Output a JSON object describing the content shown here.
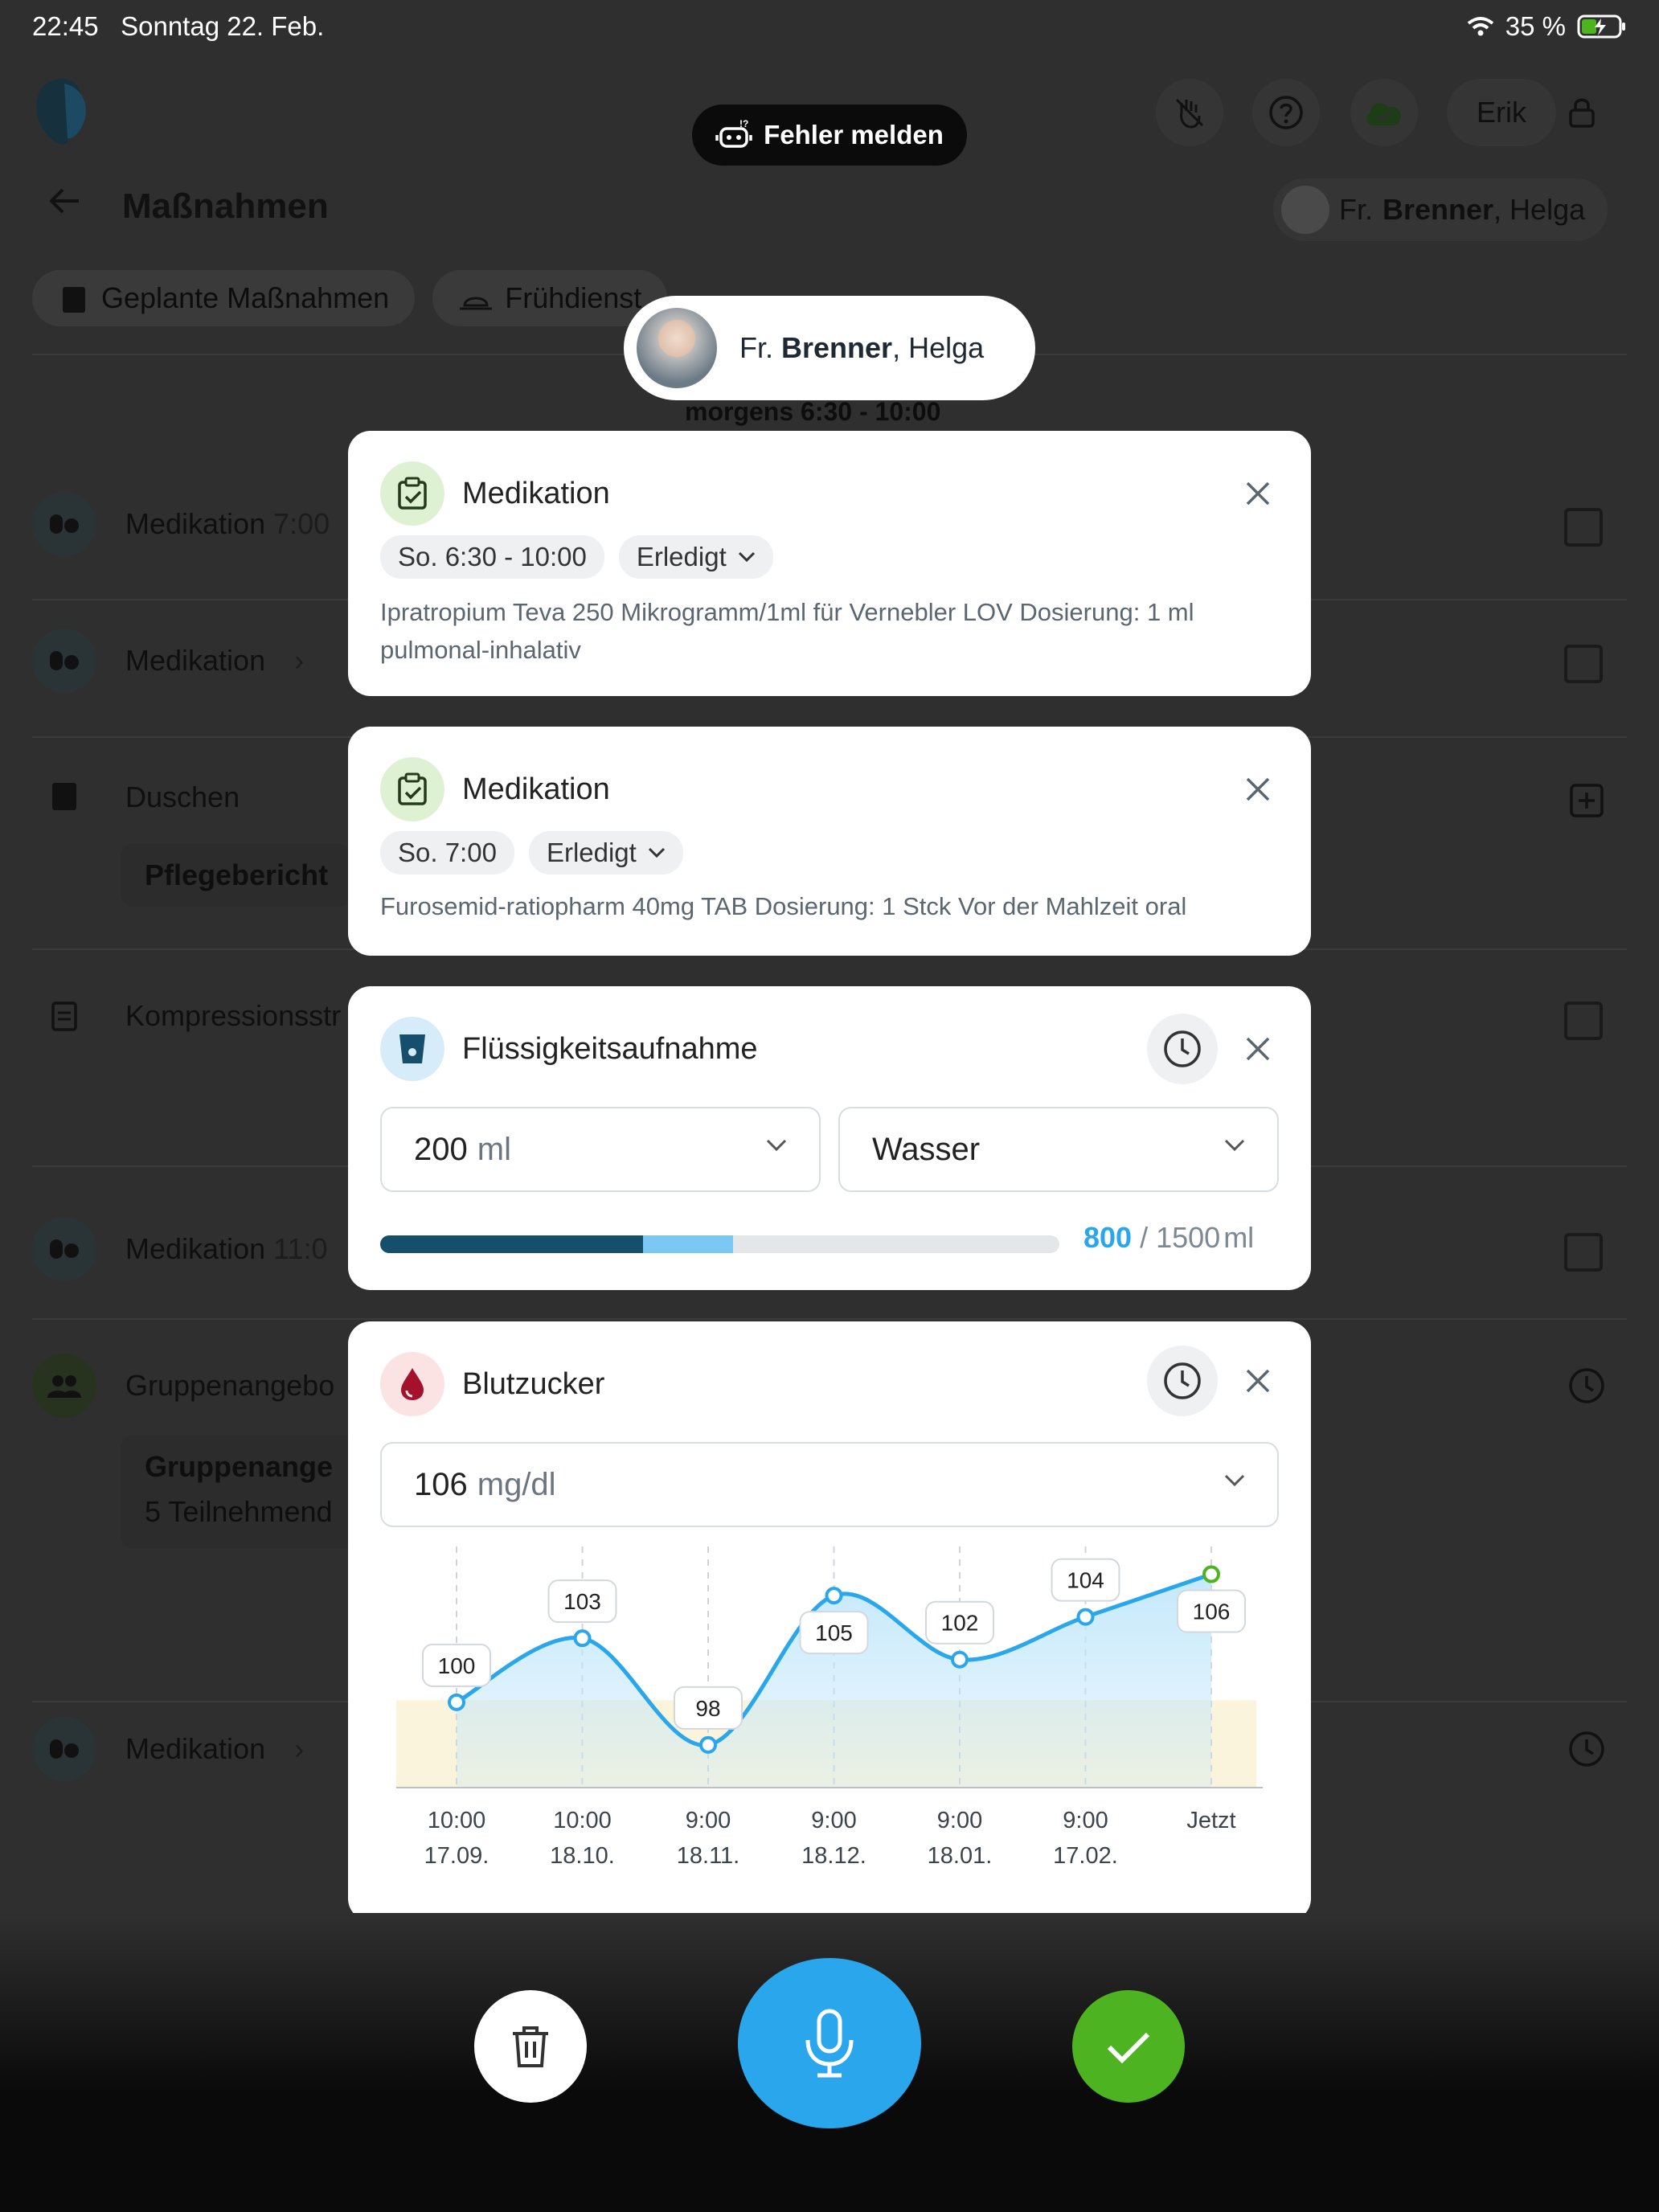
{
  "statusbar": {
    "time": "22:45",
    "date": "Sonntag 22. Feb.",
    "battery": "35 %"
  },
  "header": {
    "report_button": "Fehler melden",
    "user": "Erik",
    "page_title": "Maßnahmen",
    "patient_salutation": "Fr.",
    "patient_last": "Brenner",
    "patient_first": ", Helga"
  },
  "tabs": [
    {
      "label": "Geplante Maßnahmen"
    },
    {
      "label": "Frühdienst"
    }
  ],
  "background_list": {
    "section_label": "morgens  6:30 - 10:00",
    "rows": [
      {
        "label": "Medikation",
        "extra": "7:00"
      },
      {
        "label": "Medikation",
        "extra": "›"
      },
      {
        "label": "Duschen",
        "extra": ""
      },
      {
        "label": "Kompressionsstr",
        "extra": ""
      },
      {
        "label": "Medikation",
        "extra": "11:0"
      },
      {
        "label": "Gruppenangebo",
        "extra": ""
      },
      {
        "label": "Medikation",
        "extra": "›"
      }
    ],
    "pflegebericht": "Pflegebericht",
    "group_box_title": "Gruppenange",
    "group_box_sub": "5 Teilnehmend"
  },
  "patient_pill": {
    "salutation": "Fr.",
    "last": "Brenner",
    "first": ", Helga"
  },
  "cards": {
    "med1": {
      "title": "Medikation",
      "time": "So. 6:30 - 10:00",
      "status": "Erledigt",
      "desc": "Ipratropium Teva 250 Mikrogramm/1ml für Vernebler LOV Dosierung: 1 ml pulmonal-inhalativ"
    },
    "med2": {
      "title": "Medikation",
      "time": "So. 7:00",
      "status": "Erledigt",
      "desc": "Furosemid-ratiopharm 40mg TAB Dosierung: 1 Stck Vor der Mahlzeit oral"
    },
    "fluid": {
      "title": "Flüssigkeitsaufnahme",
      "amount": "200",
      "amount_unit": "ml",
      "drink": "Wasser",
      "current": "800",
      "target": "/ 1500",
      "unit": "ml",
      "progress_existing": 0.3867,
      "progress_new": 0.1333
    },
    "sugar": {
      "title": "Blutzucker",
      "value": "106",
      "unit": "mg/dl"
    }
  },
  "chart_data": {
    "type": "line",
    "x": [
      "10:00 17.09.",
      "10:00 18.10.",
      "9:00 18.11.",
      "9:00 18.12.",
      "9:00 18.01.",
      "9:00 17.02.",
      "Jetzt"
    ],
    "x_lines": [
      [
        "10:00",
        "17.09."
      ],
      [
        "10:00",
        "18.10."
      ],
      [
        "9:00",
        "18.11."
      ],
      [
        "9:00",
        "18.12."
      ],
      [
        "9:00",
        "18.01."
      ],
      [
        "9:00",
        "17.02."
      ],
      [
        "Jetzt",
        ""
      ]
    ],
    "values": [
      100,
      103,
      98,
      105,
      102,
      104,
      106
    ],
    "ylim": [
      96,
      107
    ],
    "target_band": [
      96,
      100.1
    ],
    "colors": {
      "line": "#2aa6ec",
      "area": "#bfe6fb",
      "band": "#fbf4dc",
      "current": "#4db321"
    }
  },
  "colors": {
    "accent": "#2aa6ec",
    "success": "#4db321",
    "dark": "#154f6b"
  }
}
